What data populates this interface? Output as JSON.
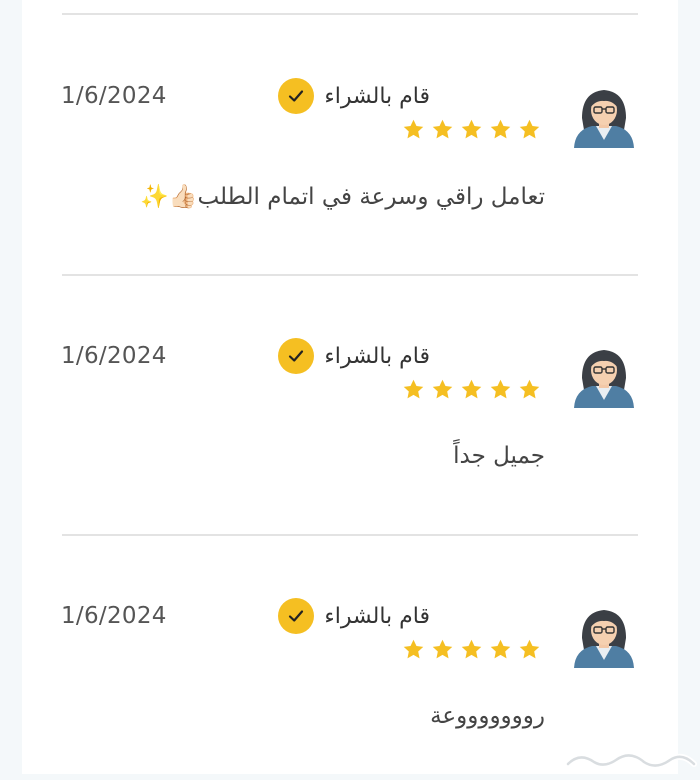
{
  "reviews": [
    {
      "purchased_label": "قام بالشراء",
      "date": "1/6/2024",
      "rating": 5,
      "comment": "تعامل راقي وسرعة في اتمام الطلب👍🏻✨"
    },
    {
      "purchased_label": "قام بالشراء",
      "date": "1/6/2024",
      "rating": 5,
      "comment": "جميل جداً"
    },
    {
      "purchased_label": "قام بالشراء",
      "date": "1/6/2024",
      "rating": 5,
      "comment": "روووووووعة"
    }
  ],
  "colors": {
    "accent": "#f5bf22",
    "star": "#f5bf22"
  },
  "icons": {
    "avatar": "user-avatar-icon",
    "check": "checkmark-icon",
    "star": "star-icon"
  },
  "watermark": {
    "text": "حراج"
  }
}
